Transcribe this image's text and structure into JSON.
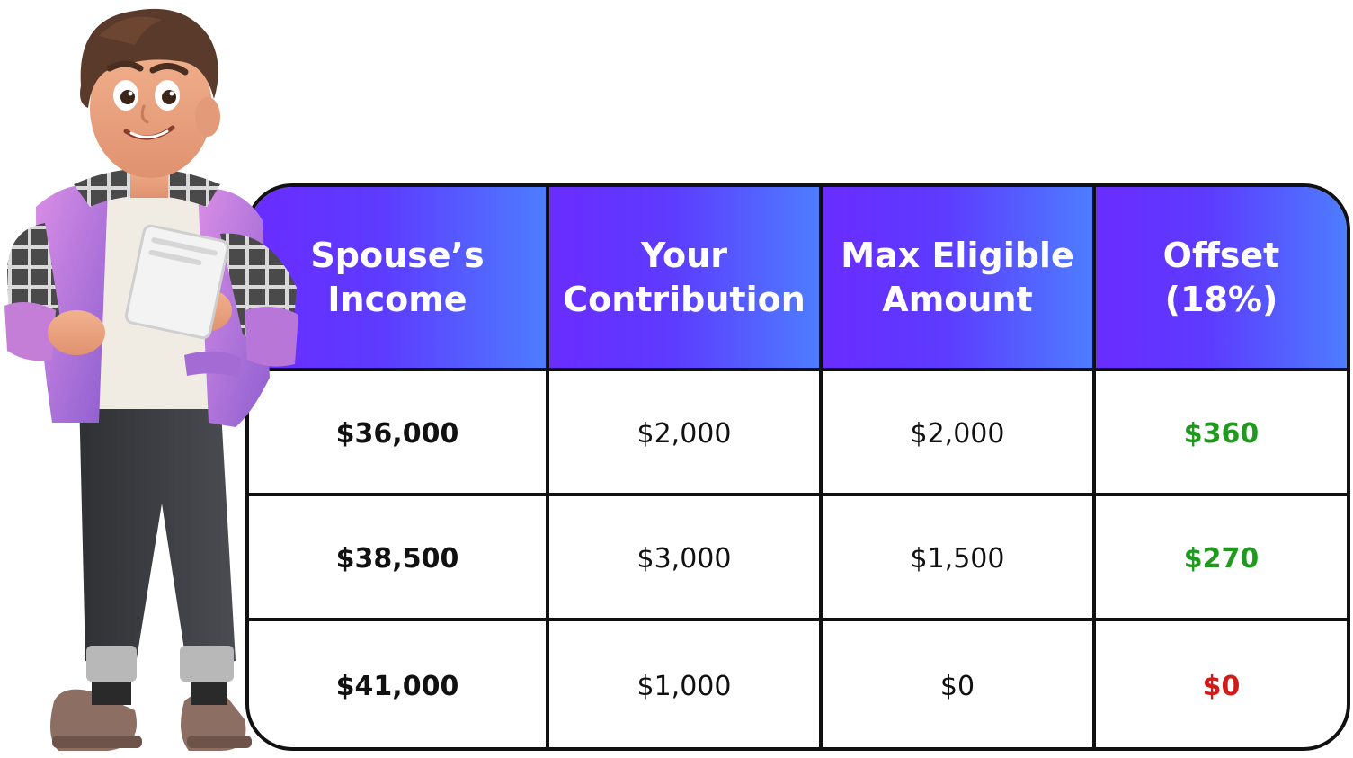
{
  "table": {
    "headers": [
      {
        "line1": "Spouse’s",
        "line2": "Income"
      },
      {
        "line1": "Your",
        "line2": "Contribution"
      },
      {
        "line1": "Max Eligible",
        "line2": "Amount"
      },
      {
        "line1": "Offset (18%)",
        "line2": ""
      }
    ],
    "rows": [
      {
        "income": "$36,000",
        "contribution": "$2,000",
        "max_eligible": "$2,000",
        "offset": "$360",
        "offset_status": "positive"
      },
      {
        "income": "$38,500",
        "contribution": "$3,000",
        "max_eligible": "$1,500",
        "offset": "$270",
        "offset_status": "positive"
      },
      {
        "income": "$41,000",
        "contribution": "$1,000",
        "max_eligible": "$0",
        "offset": "$0",
        "offset_status": "zero"
      }
    ]
  },
  "colors": {
    "header_gradient_start": "#6a2cff",
    "header_gradient_end": "#4d7dff",
    "positive": "#1f9a1f",
    "zero": "#d11a1a",
    "border": "#111111"
  },
  "illustration": {
    "subject": "cartoon-man-holding-notepad-icon"
  }
}
